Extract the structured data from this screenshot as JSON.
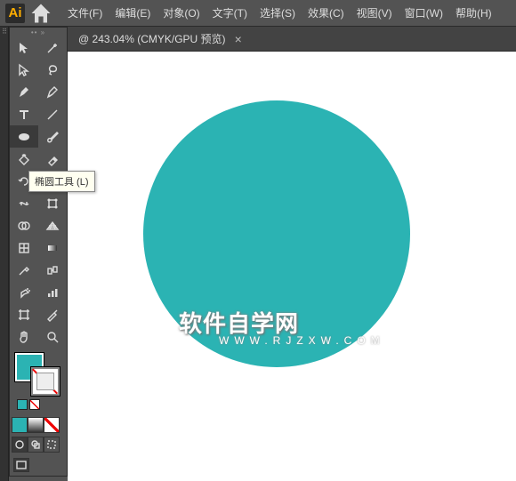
{
  "app": {
    "logo": "Ai"
  },
  "menu": {
    "file": "文件(F)",
    "edit": "编辑(E)",
    "object": "对象(O)",
    "type": "文字(T)",
    "select": "选择(S)",
    "effect": "效果(C)",
    "view": "视图(V)",
    "window": "窗口(W)",
    "help": "帮助(H)"
  },
  "tab": {
    "title": "@ 243.04%  (CMYK/GPU 预览)",
    "close": "×"
  },
  "tooltip": {
    "text": "椭圆工具 (L)"
  },
  "colors": {
    "fill": "#2bb3b3",
    "accent": "#2bb3b3",
    "mini1": "#2bb3b3",
    "mini2": "#888888",
    "mini3": "#222222"
  },
  "watermark": {
    "main": "软件自学网",
    "sub": "WWW.RJZXW.COM"
  },
  "chart_data": null
}
